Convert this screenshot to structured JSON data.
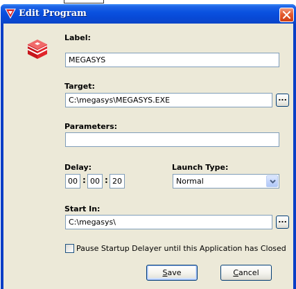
{
  "window": {
    "title": "Edit Program"
  },
  "form": {
    "label": {
      "caption": "Label:",
      "value": "MEGASYS"
    },
    "target": {
      "caption": "Target:",
      "value": "C:\\megasys\\MEGASYS.EXE",
      "browse_label": "..."
    },
    "parameters": {
      "caption": "Parameters:",
      "value": ""
    },
    "delay": {
      "caption": "Delay:",
      "hours": "00",
      "minutes": "00",
      "seconds": "20",
      "separator": ":"
    },
    "launch_type": {
      "caption": "Launch Type:",
      "selected": "Normal"
    },
    "start_in": {
      "caption": "Start In:",
      "value": "C:\\megasys\\",
      "browse_label": "..."
    },
    "pause_checkbox": {
      "label": "Pause Startup Delayer until this Application has Closed",
      "checked": false
    }
  },
  "buttons": {
    "save": {
      "accel": "S",
      "rest": "ave"
    },
    "cancel": {
      "accel": "C",
      "rest": "ancel"
    }
  },
  "colors": {
    "titlebar": "#0a52e0",
    "client_bg": "#ece9d8",
    "close_button": "#e35b31",
    "input_border": "#7f9db9",
    "icon_red": "#e0262b"
  }
}
